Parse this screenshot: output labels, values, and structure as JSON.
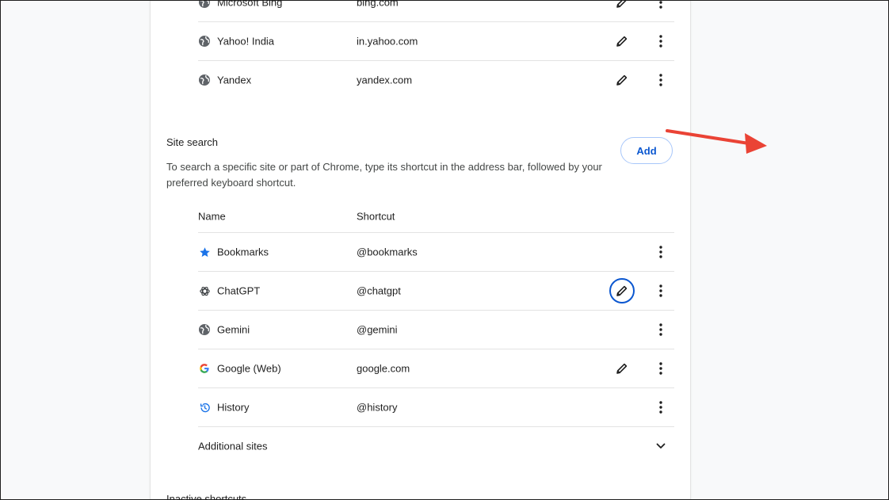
{
  "search_engines": [
    {
      "name": "Microsoft Bing",
      "shortcut": "bing.com",
      "icon": "globe-icon",
      "editable": true
    },
    {
      "name": "Yahoo! India",
      "shortcut": "in.yahoo.com",
      "icon": "globe-icon",
      "editable": true
    },
    {
      "name": "Yandex",
      "shortcut": "yandex.com",
      "icon": "globe-icon",
      "editable": true
    }
  ],
  "site_search": {
    "title": "Site search",
    "description": "To search a specific site or part of Chrome, type its shortcut in the address bar, followed by your preferred keyboard shortcut.",
    "add_label": "Add",
    "columns": {
      "name": "Name",
      "shortcut": "Shortcut"
    },
    "items": [
      {
        "name": "Bookmarks",
        "shortcut": "@bookmarks",
        "icon": "star-icon",
        "editable": false
      },
      {
        "name": "ChatGPT",
        "shortcut": "@chatgpt",
        "icon": "openai-icon",
        "editable": true,
        "focused": true
      },
      {
        "name": "Gemini",
        "shortcut": "@gemini",
        "icon": "globe-icon",
        "editable": false
      },
      {
        "name": "Google (Web)",
        "shortcut": "google.com",
        "icon": "google-icon",
        "editable": true
      },
      {
        "name": "History",
        "shortcut": "@history",
        "icon": "history-icon",
        "editable": false
      }
    ],
    "additional_sites_label": "Additional sites"
  },
  "inactive_shortcuts": {
    "title": "Inactive shortcuts"
  },
  "colors": {
    "accent": "#0b57d0",
    "annotation_arrow": "#ea4335",
    "star": "#1a73e8"
  }
}
